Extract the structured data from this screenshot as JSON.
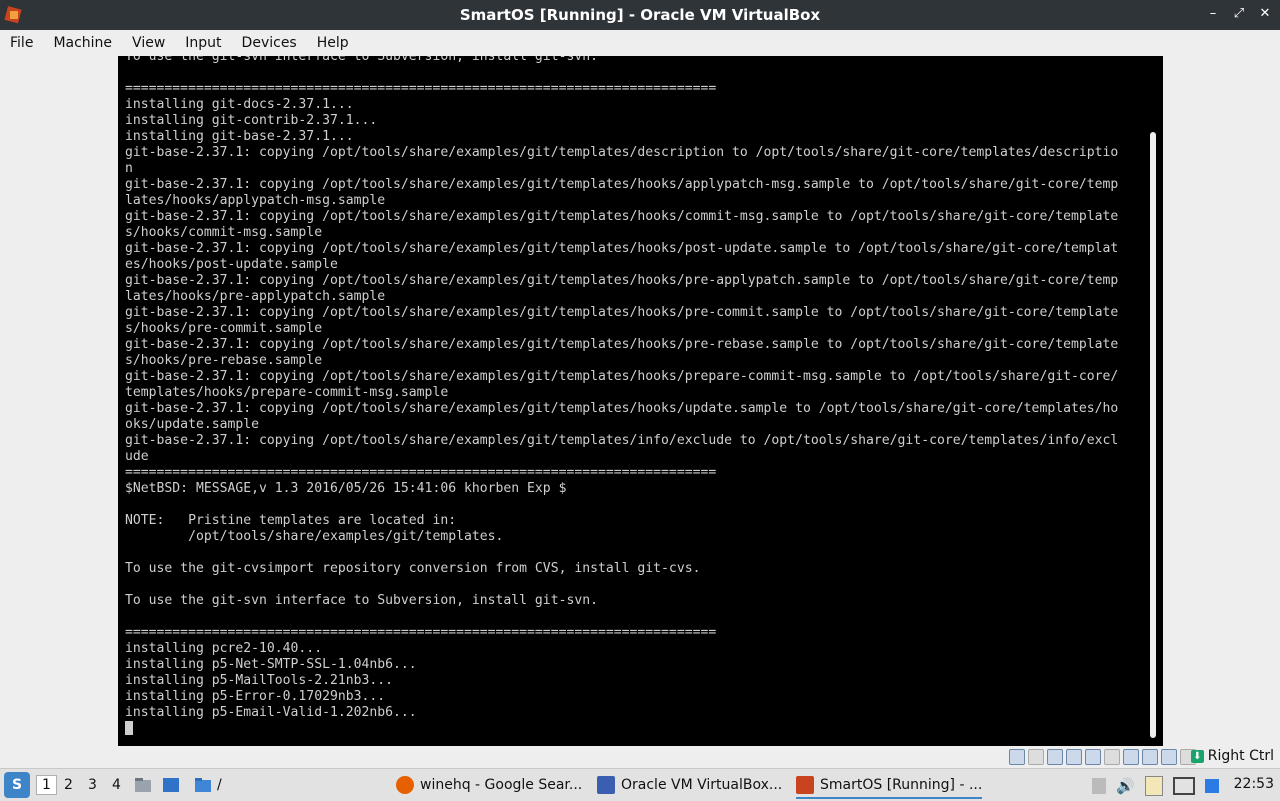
{
  "window": {
    "title": "SmartOS [Running] - Oracle VM VirtualBox",
    "controls": {
      "minimize": "–",
      "restore": "⤢",
      "close": "✕"
    }
  },
  "menu": [
    "File",
    "Machine",
    "View",
    "Input",
    "Devices",
    "Help"
  ],
  "terminal": {
    "lines": [
      "To use the git-svn interface to Subversion, install git-svn.",
      "",
      "===========================================================================",
      "installing git-docs-2.37.1...",
      "installing git-contrib-2.37.1...",
      "installing git-base-2.37.1...",
      "git-base-2.37.1: copying /opt/tools/share/examples/git/templates/description to /opt/tools/share/git-core/templates/descriptio",
      "n",
      "git-base-2.37.1: copying /opt/tools/share/examples/git/templates/hooks/applypatch-msg.sample to /opt/tools/share/git-core/temp",
      "lates/hooks/applypatch-msg.sample",
      "git-base-2.37.1: copying /opt/tools/share/examples/git/templates/hooks/commit-msg.sample to /opt/tools/share/git-core/template",
      "s/hooks/commit-msg.sample",
      "git-base-2.37.1: copying /opt/tools/share/examples/git/templates/hooks/post-update.sample to /opt/tools/share/git-core/templat",
      "es/hooks/post-update.sample",
      "git-base-2.37.1: copying /opt/tools/share/examples/git/templates/hooks/pre-applypatch.sample to /opt/tools/share/git-core/temp",
      "lates/hooks/pre-applypatch.sample",
      "git-base-2.37.1: copying /opt/tools/share/examples/git/templates/hooks/pre-commit.sample to /opt/tools/share/git-core/template",
      "s/hooks/pre-commit.sample",
      "git-base-2.37.1: copying /opt/tools/share/examples/git/templates/hooks/pre-rebase.sample to /opt/tools/share/git-core/template",
      "s/hooks/pre-rebase.sample",
      "git-base-2.37.1: copying /opt/tools/share/examples/git/templates/hooks/prepare-commit-msg.sample to /opt/tools/share/git-core/",
      "templates/hooks/prepare-commit-msg.sample",
      "git-base-2.37.1: copying /opt/tools/share/examples/git/templates/hooks/update.sample to /opt/tools/share/git-core/templates/ho",
      "oks/update.sample",
      "git-base-2.37.1: copying /opt/tools/share/examples/git/templates/info/exclude to /opt/tools/share/git-core/templates/info/excl",
      "ude",
      "===========================================================================",
      "$NetBSD: MESSAGE,v 1.3 2016/05/26 15:41:06 khorben Exp $",
      "",
      "NOTE:   Pristine templates are located in:",
      "        /opt/tools/share/examples/git/templates.",
      "",
      "To use the git-cvsimport repository conversion from CVS, install git-cvs.",
      "",
      "To use the git-svn interface to Subversion, install git-svn.",
      "",
      "===========================================================================",
      "installing pcre2-10.40...",
      "installing p5-Net-SMTP-SSL-1.04nb6...",
      "installing p5-MailTools-2.21nb3...",
      "installing p5-Error-0.17029nb3...",
      "installing p5-Email-Valid-1.202nb6..."
    ]
  },
  "statusbar": {
    "host_key": "Right Ctrl"
  },
  "taskbar": {
    "start_glyph": "S",
    "workspaces": [
      "1",
      "2",
      "3",
      "4"
    ],
    "folder_path": "/",
    "tasks": [
      "winehq - Google Sear...",
      "Oracle VM VirtualBox...",
      "SmartOS [Running] - ..."
    ],
    "clock": "22:53"
  }
}
